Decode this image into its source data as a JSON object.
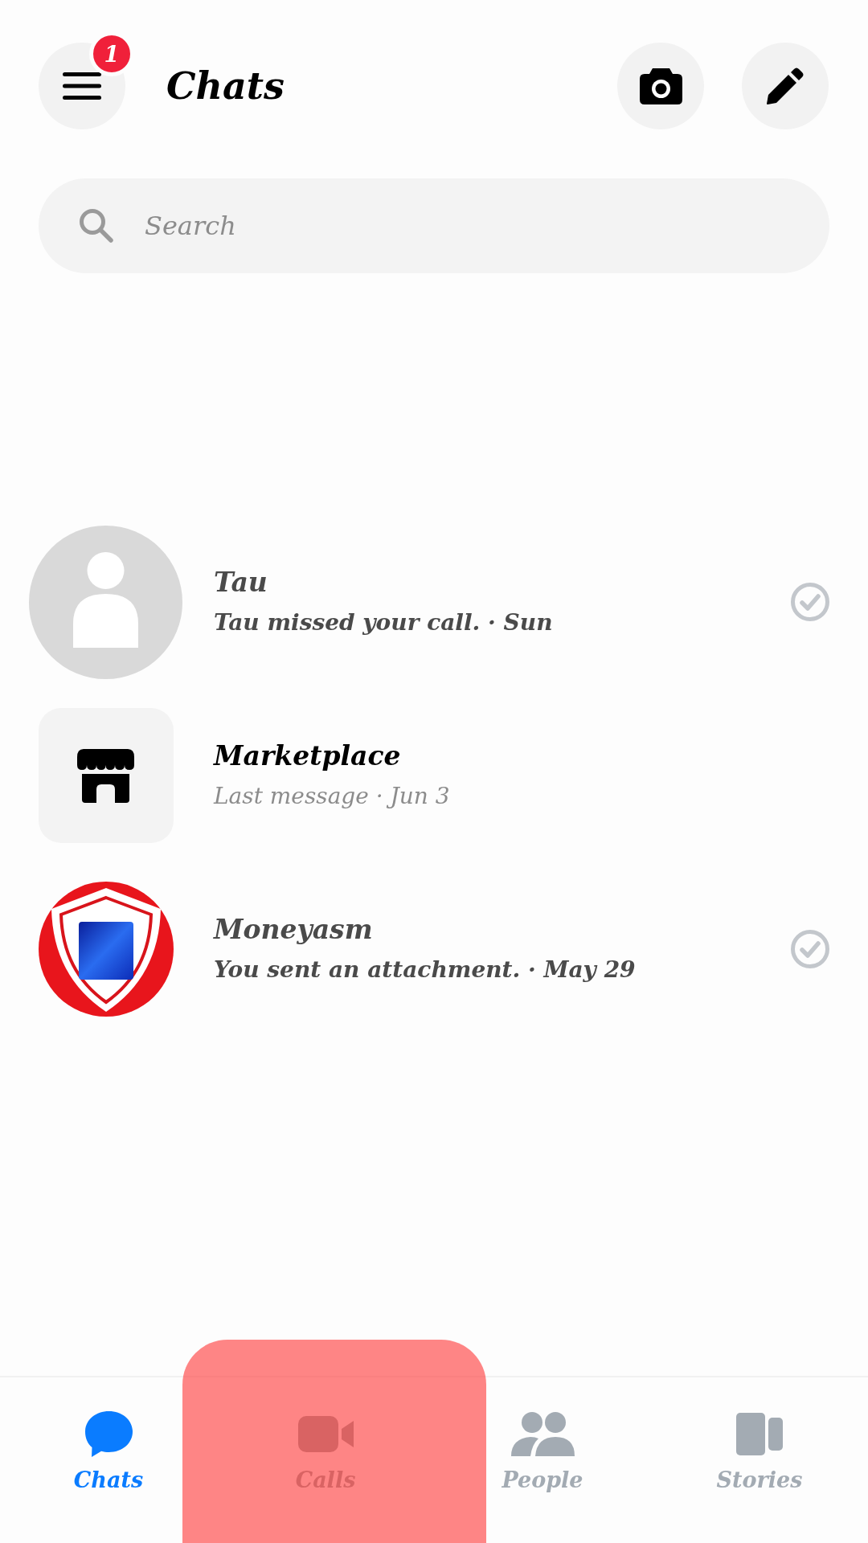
{
  "header": {
    "title": "Chats",
    "menu_badge": "1"
  },
  "search": {
    "placeholder": "Search"
  },
  "chats": [
    {
      "kind": "person",
      "name": "Tau",
      "preview": "Tau missed your call. · Sun",
      "seen": true
    },
    {
      "kind": "marketplace",
      "name": "Marketplace",
      "preview": "Last message · Jun 3",
      "seen": false
    },
    {
      "kind": "logo",
      "name": "Moneyasm",
      "preview": "You sent an attachment. · May 29",
      "seen": true
    }
  ],
  "nav": [
    {
      "kind": "chats",
      "label": "Chats",
      "selected": true,
      "highlighted": false
    },
    {
      "kind": "calls",
      "label": "Calls",
      "selected": false,
      "highlighted": true
    },
    {
      "kind": "people",
      "label": "People",
      "selected": false,
      "highlighted": false
    },
    {
      "kind": "stories",
      "label": "Stories",
      "selected": false,
      "highlighted": false
    }
  ]
}
